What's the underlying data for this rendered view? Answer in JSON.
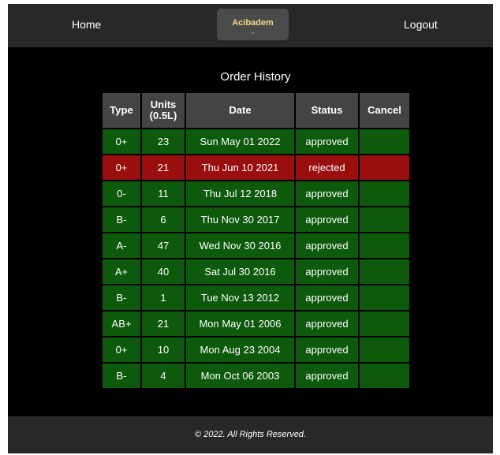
{
  "nav": {
    "home_label": "Home",
    "brand_label": "Acibadem",
    "brand_chevron": "⌄",
    "logout_label": "Logout"
  },
  "page_title": "Order History",
  "table": {
    "headers": {
      "type": "Type",
      "units": "Units (0.5L)",
      "date": "Date",
      "status": "Status",
      "cancel": "Cancel"
    },
    "rows": [
      {
        "type": "0+",
        "units": "23",
        "date": "Sun May 01 2022",
        "status": "approved",
        "cancel": ""
      },
      {
        "type": "0+",
        "units": "21",
        "date": "Thu Jun 10 2021",
        "status": "rejected",
        "cancel": ""
      },
      {
        "type": "0-",
        "units": "11",
        "date": "Thu Jul 12 2018",
        "status": "approved",
        "cancel": ""
      },
      {
        "type": "B-",
        "units": "6",
        "date": "Thu Nov 30 2017",
        "status": "approved",
        "cancel": ""
      },
      {
        "type": "A-",
        "units": "47",
        "date": "Wed Nov 30 2016",
        "status": "approved",
        "cancel": ""
      },
      {
        "type": "A+",
        "units": "40",
        "date": "Sat Jul 30 2016",
        "status": "approved",
        "cancel": ""
      },
      {
        "type": "B-",
        "units": "1",
        "date": "Tue Nov 13 2012",
        "status": "approved",
        "cancel": ""
      },
      {
        "type": "AB+",
        "units": "21",
        "date": "Mon May 01 2006",
        "status": "approved",
        "cancel": ""
      },
      {
        "type": "0+",
        "units": "10",
        "date": "Mon Aug 23 2004",
        "status": "approved",
        "cancel": ""
      },
      {
        "type": "B-",
        "units": "4",
        "date": "Mon Oct 06 2003",
        "status": "approved",
        "cancel": ""
      }
    ]
  },
  "footer": {
    "text": "© 2022. All Rights Reserved."
  },
  "colors": {
    "approved_row": "#0d5a0d",
    "rejected_row": "#9a0e0e",
    "header_cell": "#444444",
    "navbar": "#282828",
    "brand_text": "#f3d98b"
  }
}
